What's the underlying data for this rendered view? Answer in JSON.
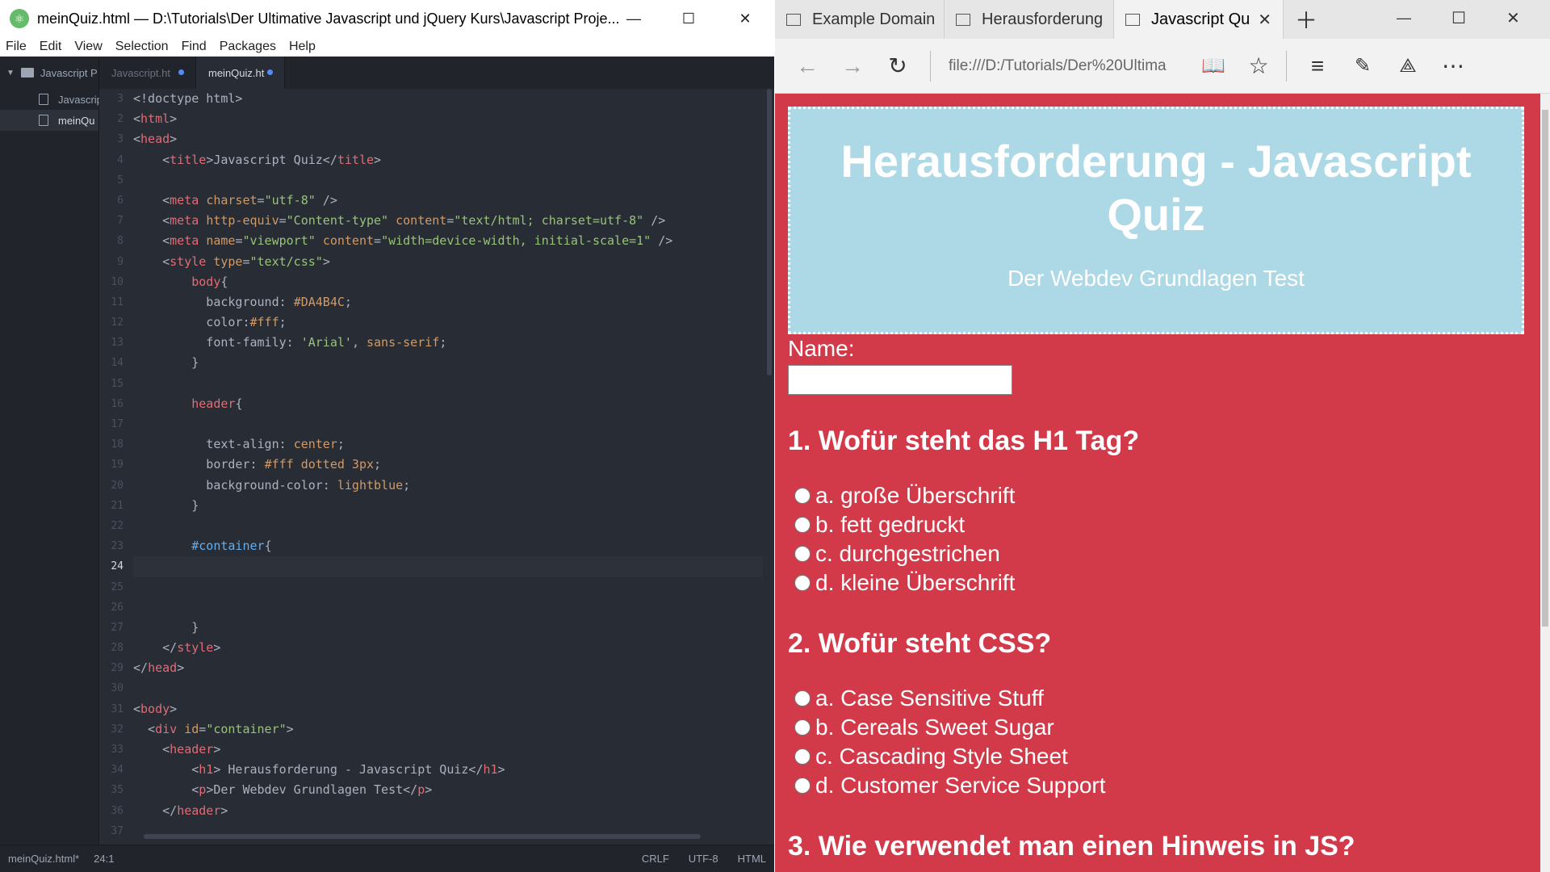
{
  "atom": {
    "title": "meinQuiz.html — D:\\Tutorials\\Der Ultimative Javascript und jQuery Kurs\\Javascript Proje...",
    "menu": [
      "File",
      "Edit",
      "View",
      "Selection",
      "Find",
      "Packages",
      "Help"
    ],
    "tree": {
      "root": "Javascript P",
      "files": [
        "Javascrip",
        "meinQu"
      ]
    },
    "tabs": [
      "Javascript.ht",
      "meinQuiz.ht"
    ],
    "line_numbers": [
      "3",
      "2",
      "3",
      "4",
      "5",
      "6",
      "7",
      "8",
      "9",
      "10",
      "11",
      "12",
      "13",
      "14",
      "15",
      "16",
      "17",
      "18",
      "19",
      "20",
      "21",
      "22",
      "23",
      "24",
      "25",
      "26",
      "27",
      "28",
      "29",
      "30",
      "31",
      "32",
      "33",
      "34",
      "35",
      "36",
      "37"
    ],
    "status": {
      "file": "meinQuiz.html*",
      "cursor": "24:1",
      "line_ending": "CRLF",
      "encoding": "UTF-8",
      "grammar": "HTML"
    }
  },
  "browser": {
    "tabs": [
      "Example Domain",
      "Herausforderung",
      "Javascript Qu"
    ],
    "address": "file:///D:/Tutorials/Der%20Ultima",
    "page": {
      "title": "Herausforderung - Javascript Quiz",
      "subtitle": "Der Webdev Grundlagen Test",
      "name_label": "Name:",
      "name_value": "",
      "questions": [
        {
          "text": "1. Wofür steht das H1 Tag?",
          "options": [
            "a. große Überschrift",
            "b. fett gedruckt",
            "c. durchgestrichen",
            "d. kleine Überschrift"
          ]
        },
        {
          "text": "2. Wofür steht CSS?",
          "options": [
            "a. Case Sensitive Stuff",
            "b. Cereals Sweet Sugar",
            "c. Cascading Style Sheet",
            "d. Customer Service Support"
          ]
        },
        {
          "text": "3. Wie verwendet man einen Hinweis in JS?",
          "options": []
        }
      ]
    }
  }
}
